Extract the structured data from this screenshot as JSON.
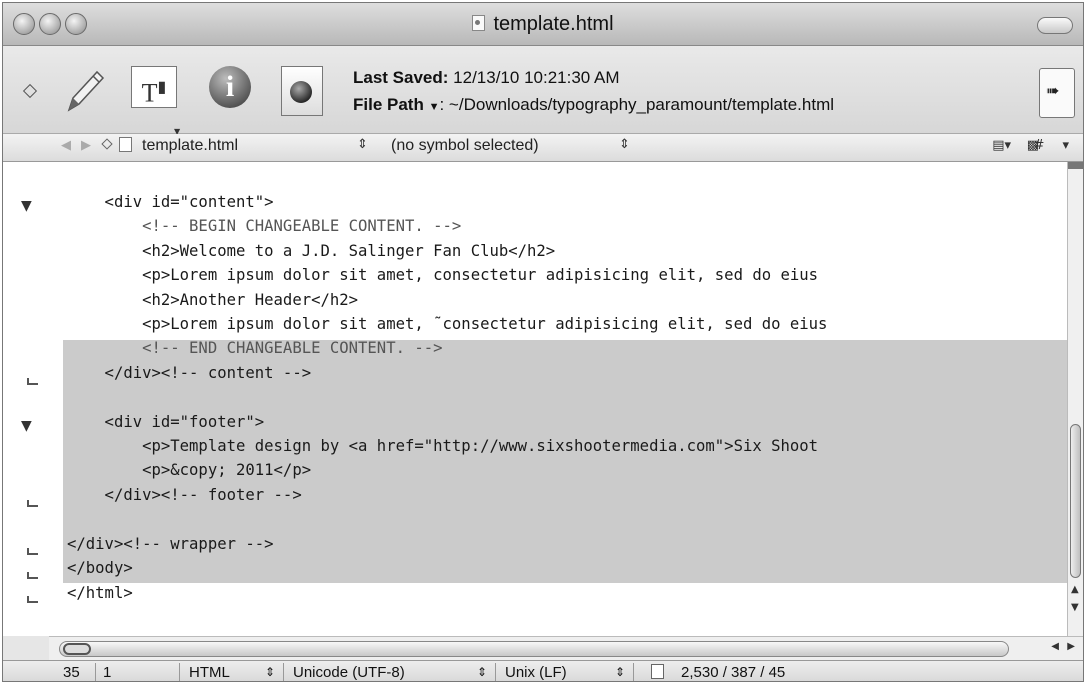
{
  "window": {
    "title": "template.html"
  },
  "toolbar": {
    "last_saved_label": "Last Saved:",
    "last_saved_value": "12/13/10 10:21:30 AM",
    "file_path_label": "File Path",
    "file_path_value": ": ~/Downloads/typography_paramount/template.html",
    "text_tool_glyph": "T",
    "info_glyph": "i"
  },
  "navbar": {
    "file_name": "template.html",
    "symbol_label": "(no symbol selected)",
    "tools_label": "# ▾"
  },
  "editor": {
    "code_lines": [
      "    <div id=\"content\">",
      "        <!-- BEGIN CHANGEABLE CONTENT. -->",
      "        <h2>Welcome to a J.D. Salinger Fan Club</h2>",
      "        <p>Lorem ipsum dolor sit amet, consectetur adipisicing elit, sed do eius",
      "        <h2>Another Header</h2>",
      "        <p>Lorem ipsum dolor sit amet, ˜consectetur adipisicing elit, sed do eius",
      "        <!-- END CHANGEABLE CONTENT. -->",
      "    </div><!-- content -->",
      "",
      "    <div id=\"footer\">",
      "        <p>Template design by <a href=\"http://www.sixshootermedia.com\">Six Shoot",
      "        <p>&copy; 2011</p>",
      "    </div><!-- footer -->",
      "",
      "</div><!-- wrapper -->",
      "</body>",
      "</html>"
    ]
  },
  "status": {
    "line": "35",
    "column": "1",
    "language": "HTML",
    "encoding": "Unicode (UTF-8)",
    "line_endings": "Unix (LF)",
    "counts": "2,530 / 387 / 45"
  }
}
